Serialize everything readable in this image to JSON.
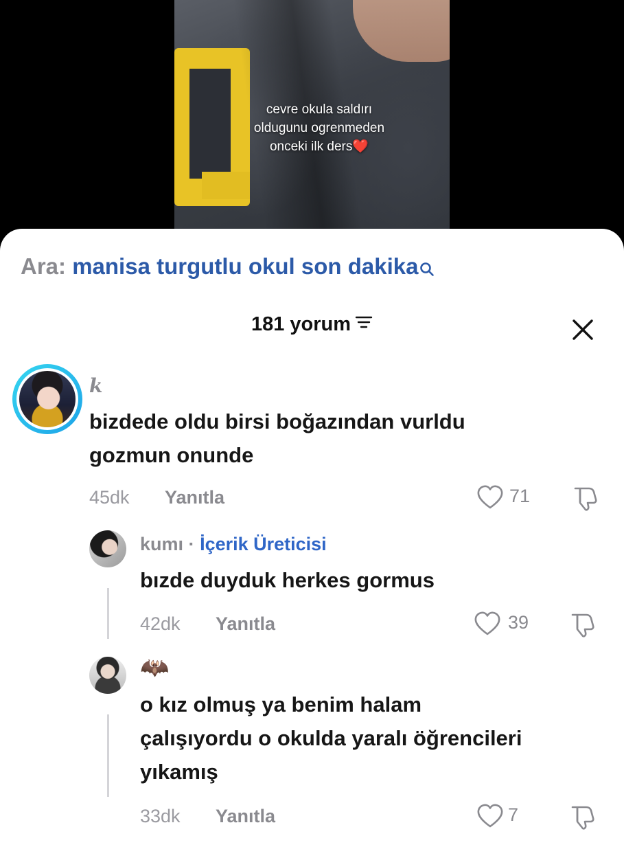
{
  "video": {
    "caption_lines": [
      "cevre okula saldırı",
      "oldugunu ogrenmeden",
      "onceki ilk ders"
    ],
    "caption_heart": "❤️"
  },
  "search": {
    "prefix": "Ara:",
    "query": "manisa turgutlu okul son dakika"
  },
  "header": {
    "count_label": "181 yorum"
  },
  "comments": [
    {
      "username": "k",
      "text_lines": [
        "bizdede oldu birsi boğazından vurldu",
        "gozmun onunde"
      ],
      "time": "45dk",
      "reply_label": "Yanıtla",
      "likes": "71"
    },
    {
      "username": "kumı",
      "separator": "·",
      "badge": "İçerik Üreticisi",
      "text_lines": [
        "bızde duyduk herkes gormus"
      ],
      "time": "42dk",
      "reply_label": "Yanıtla",
      "likes": "39"
    },
    {
      "username": "🦇",
      "text_lines": [
        "o kız olmuş ya benim halam",
        "çalışıyordu o okulda yaralı öğrencileri",
        "yıkamış"
      ],
      "time": "33dk",
      "reply_label": "Yanıtla",
      "likes": "7"
    }
  ],
  "colors": {
    "accent_blue": "#2c5aa8",
    "creator_badge": "#2f66c7",
    "muted_text": "#8a8a8f",
    "avatar_ring": "#36d6f0"
  },
  "icons": [
    "search-icon",
    "sort-icon",
    "close-icon",
    "heart-icon",
    "dislike-icon"
  ]
}
